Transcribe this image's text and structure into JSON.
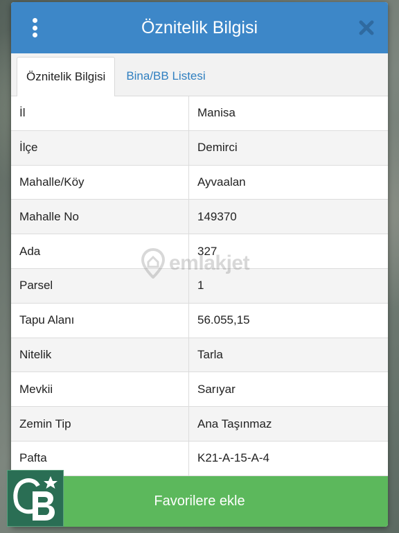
{
  "header": {
    "title": "Öznitelik Bilgisi"
  },
  "tabs": [
    {
      "label": "Öznitelik Bilgisi"
    },
    {
      "label": "Bina/BB Listesi"
    }
  ],
  "rows": [
    {
      "label": "İl",
      "value": "Manisa"
    },
    {
      "label": "İlçe",
      "value": "Demirci"
    },
    {
      "label": "Mahalle/Köy",
      "value": "Ayvaalan"
    },
    {
      "label": "Mahalle No",
      "value": "149370"
    },
    {
      "label": "Ada",
      "value": "327"
    },
    {
      "label": "Parsel",
      "value": "1"
    },
    {
      "label": "Tapu Alanı",
      "value": "56.055,15"
    },
    {
      "label": "Nitelik",
      "value": "Tarla"
    },
    {
      "label": "Mevkii",
      "value": "Sarıyar"
    },
    {
      "label": "Zemin Tip",
      "value": "Ana Taşınmaz"
    },
    {
      "label": "Pafta",
      "value": "K21-A-15-A-4"
    }
  ],
  "favorite_button": {
    "label": "Favorilere ekle"
  },
  "watermark": {
    "text": "emlakjet"
  },
  "logo": {
    "text": "CB"
  },
  "colors": {
    "header": "#3d87c8",
    "button": "#5cb85c",
    "tab_link": "#2f7fc0"
  }
}
